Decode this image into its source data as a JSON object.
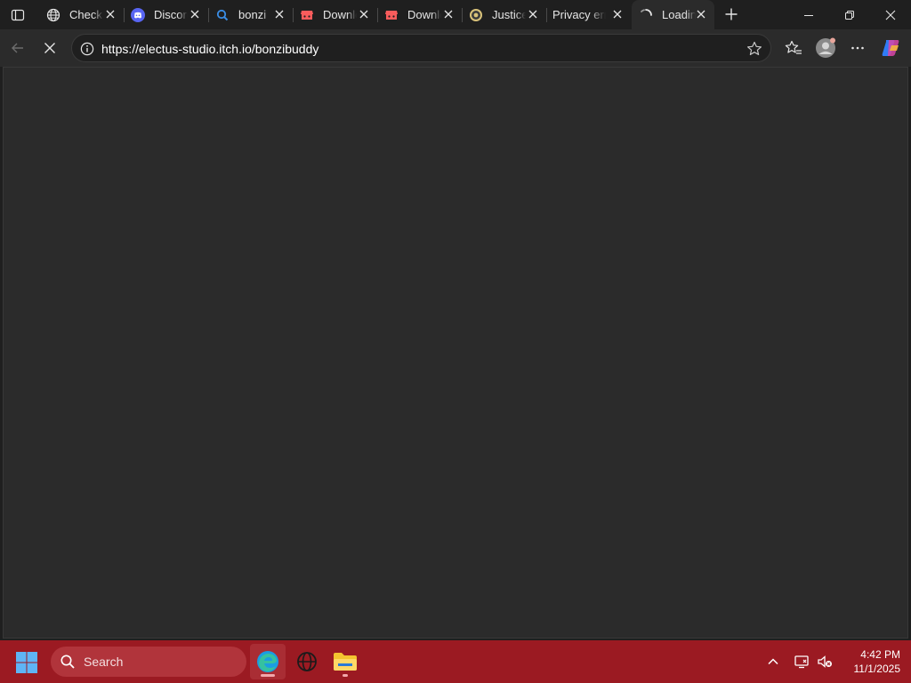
{
  "tabs": [
    {
      "label": "Check",
      "icon": "globe-icon",
      "active": false
    },
    {
      "label": "Discord",
      "icon": "discord-icon",
      "active": false
    },
    {
      "label": "bonzi",
      "icon": "search-icon",
      "active": false
    },
    {
      "label": "Download",
      "icon": "itchio-icon",
      "active": false
    },
    {
      "label": "Download",
      "icon": "itchio-icon",
      "active": false
    },
    {
      "label": "Justice",
      "icon": "justice-icon",
      "active": false
    },
    {
      "label": "Privacy error",
      "icon": "none",
      "active": false
    },
    {
      "label": "Loading",
      "icon": "loading-spinner-icon",
      "active": true
    }
  ],
  "address_bar": {
    "url": "https://electus-studio.itch.io/bonzibuddy"
  },
  "taskbar": {
    "search_placeholder": "Search",
    "apps": [
      "edge-icon",
      "globe-app-icon",
      "file-explorer-icon"
    ],
    "clock": {
      "time": "4:42 PM",
      "date": "11/1/2025"
    }
  },
  "colors": {
    "tabstrip": "#1f1f1f",
    "toolbar": "#2b2b2b",
    "taskbar": "#9b1a22",
    "search_box": "#b1343b"
  }
}
